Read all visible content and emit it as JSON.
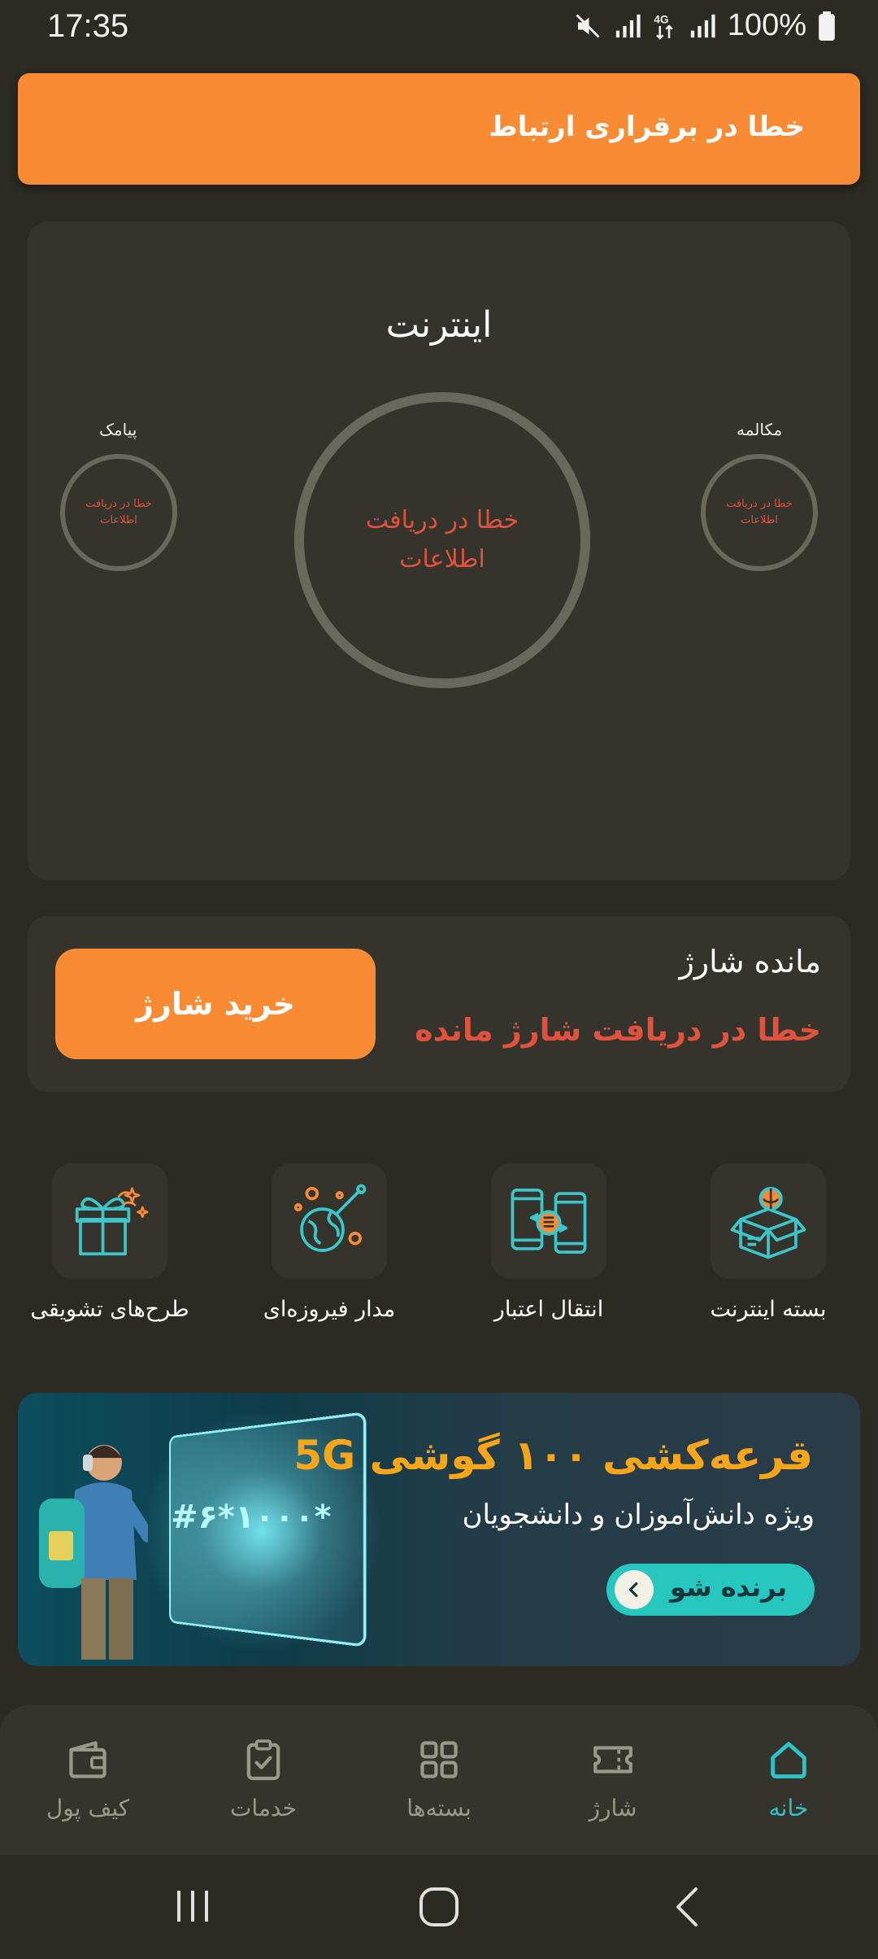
{
  "status_bar": {
    "time": "17:35",
    "battery_text": "100%",
    "network": "4G",
    "icons": [
      "mute-icon",
      "signal-icon",
      "4g-icon",
      "signal-icon",
      "battery-icon"
    ]
  },
  "toast": {
    "message": "خطا در برقراری ارتباط"
  },
  "usage": {
    "title": "اینترنت",
    "main_error": "خطا در دریافت اطلاعات",
    "left_label": "پیامک",
    "left_error": "خطا در دریافت اطلاعات",
    "right_label": "مکالمه",
    "right_error": "خطا در دریافت اطلاعات"
  },
  "balance": {
    "title": "مانده شارژ",
    "error": "خطا در دریافت شارژ مانده",
    "buy_button": "خرید شارژ"
  },
  "services": [
    {
      "label": "بسته اینترنت",
      "icon": "internet-package-icon"
    },
    {
      "label": "انتقال اعتبار",
      "icon": "credit-transfer-icon"
    },
    {
      "label": "مدار فیروزه‌ای",
      "icon": "turquoise-orbit-icon"
    },
    {
      "label": "طرح‌های تشویقی",
      "icon": "gift-icon"
    }
  ],
  "banner": {
    "title": "قرعه‌کشی ۱۰۰ گوشی 5G",
    "subtitle": "ویژه دانش‌آموزان و دانشجویان",
    "cta": "برنده شو",
    "ussd": "#۶*۱۰۰۰*"
  },
  "nav": {
    "items": [
      {
        "label": "خانه",
        "icon": "home-icon",
        "active": true
      },
      {
        "label": "شارژ",
        "icon": "ticket-icon",
        "active": false
      },
      {
        "label": "بسته‌ها",
        "icon": "grid-icon",
        "active": false
      },
      {
        "label": "خدمات",
        "icon": "clipboard-icon",
        "active": false
      },
      {
        "label": "کیف پول",
        "icon": "wallet-icon",
        "active": false
      }
    ]
  },
  "colors": {
    "accent": "#f98b34",
    "error": "#e0523e",
    "active": "#2ec3cc",
    "background": "#2b2a23",
    "card": "#35342c"
  }
}
